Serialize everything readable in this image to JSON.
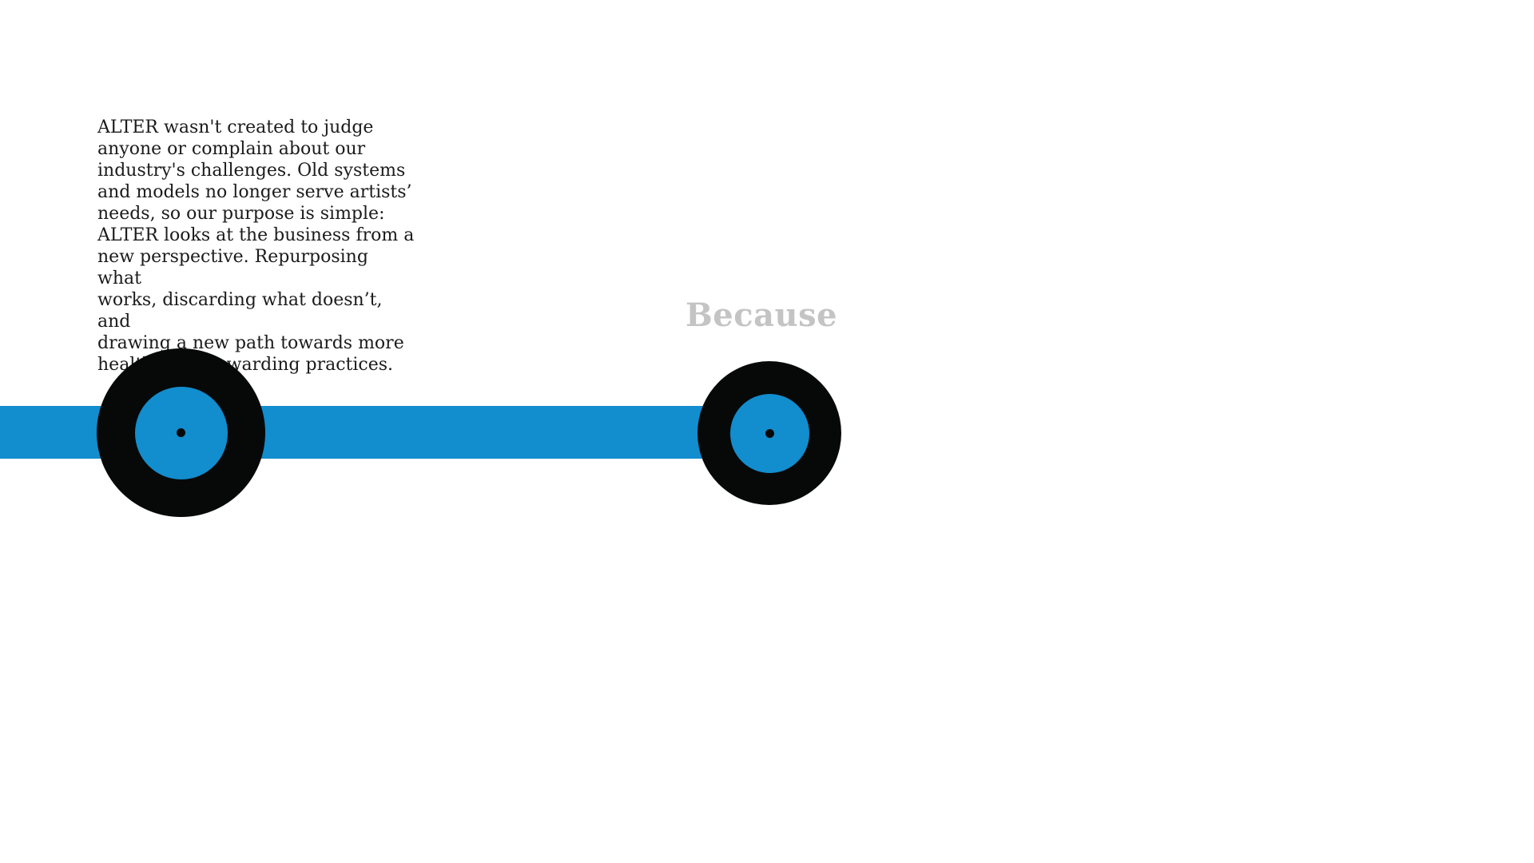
{
  "intro": {
    "paragraph": "ALTER wasn't created to judge\nanyone or complain about our\nindustry's challenges. Old systems\nand models no longer serve artists’\nneeds, so our purpose is simple:\nALTER looks at the business from a\nnew perspective. Repurposing what\nworks, discarding what doesn’t, and\ndrawing a new path towards more\nhealthy and rewarding practices."
  },
  "section": {
    "heading": "Because"
  },
  "graphics": {
    "records": [
      {
        "name": "vinyl-record",
        "label_color": "#128dcd",
        "disc_color": "#070909"
      },
      {
        "name": "vinyl-record",
        "label_color": "#128dcd",
        "disc_color": "#070909"
      }
    ]
  },
  "colors": {
    "accent": "#128dcd",
    "disc": "#070909",
    "heading": "#c4c4c4",
    "text": "#1b1b1b",
    "background": "#ffffff"
  }
}
